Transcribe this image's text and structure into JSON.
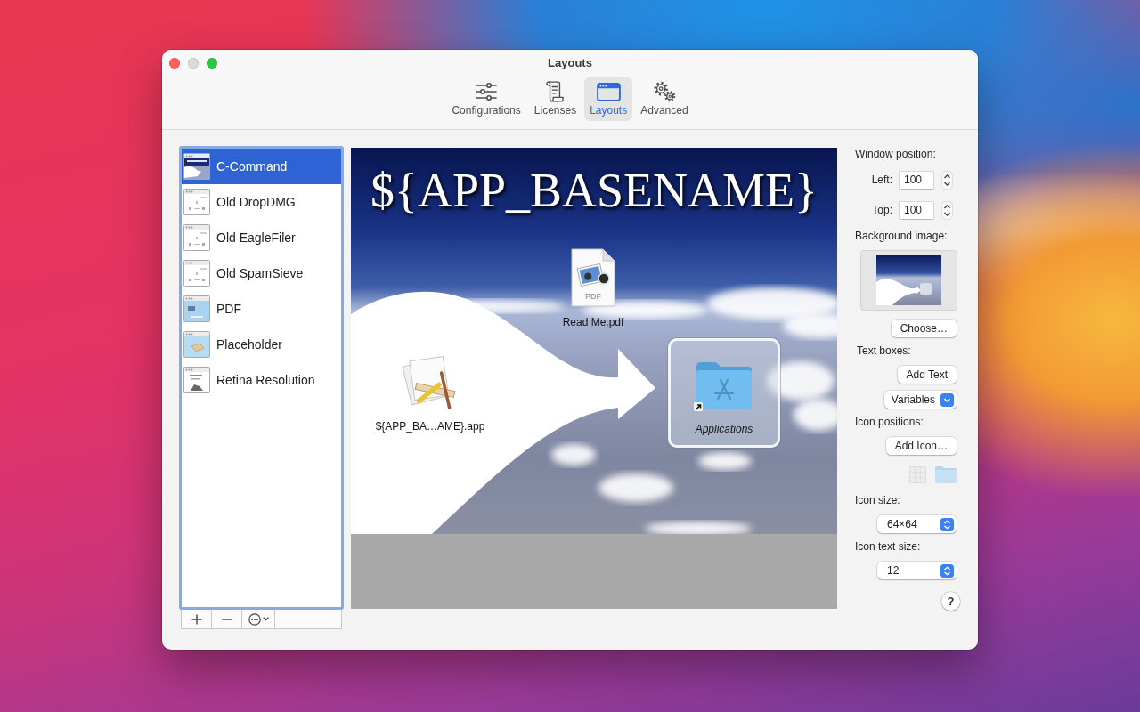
{
  "window": {
    "title": "Layouts",
    "buttons": [
      {
        "kind": "close",
        "disabled": false
      },
      {
        "kind": "minimize",
        "disabled": true
      },
      {
        "kind": "zoom",
        "disabled": false
      }
    ]
  },
  "toolbar": [
    {
      "kind": "sliders",
      "label": "Configurations",
      "selected": false
    },
    {
      "kind": "scroll",
      "label": "Licenses",
      "selected": false
    },
    {
      "kind": "window",
      "label": "Layouts",
      "selected": true
    },
    {
      "kind": "gears",
      "label": "Advanced",
      "selected": false
    }
  ],
  "layouts": {
    "focused": true,
    "items": [
      {
        "name": "C-Command",
        "kind": "dark",
        "selected": true
      },
      {
        "name": "Old DropDMG",
        "kind": "plain",
        "selected": false
      },
      {
        "name": "Old EagleFiler",
        "kind": "plain",
        "selected": false
      },
      {
        "name": "Old SpamSieve",
        "kind": "plain",
        "selected": false
      },
      {
        "name": "PDF",
        "kind": "sky",
        "selected": false
      },
      {
        "name": "Placeholder",
        "kind": "parcel",
        "selected": false
      },
      {
        "name": "Retina Resolution",
        "kind": "text",
        "selected": false
      }
    ]
  },
  "preview": {
    "title": "${APP_BASENAME}",
    "icons": [
      {
        "kind": "pdf",
        "badge": "PDF",
        "label": "Read Me.pdf",
        "alias": false,
        "selected": false
      },
      {
        "kind": "app",
        "label": "${APP_BA…AME}.app",
        "alias": false,
        "selected": false
      },
      {
        "kind": "folder",
        "label": "Applications",
        "alias": true,
        "selected": true
      }
    ]
  },
  "settings": {
    "window_position": {
      "label": "Window position:",
      "left": {
        "label": "Left:",
        "value": "100"
      },
      "top": {
        "label": "Top:",
        "value": "100"
      }
    },
    "background_image": {
      "label": "Background image:",
      "button": "Choose…"
    },
    "text_boxes": {
      "label": "Text boxes:",
      "button": "Add Text",
      "popup": "Variables"
    },
    "icon_positions": {
      "label": "Icon positions:",
      "button": "Add Icon…"
    },
    "icon_size": {
      "label": "Icon size:",
      "value": "64×64"
    },
    "icon_text_size": {
      "label": "Icon text size:",
      "value": "12"
    },
    "help": "?"
  }
}
